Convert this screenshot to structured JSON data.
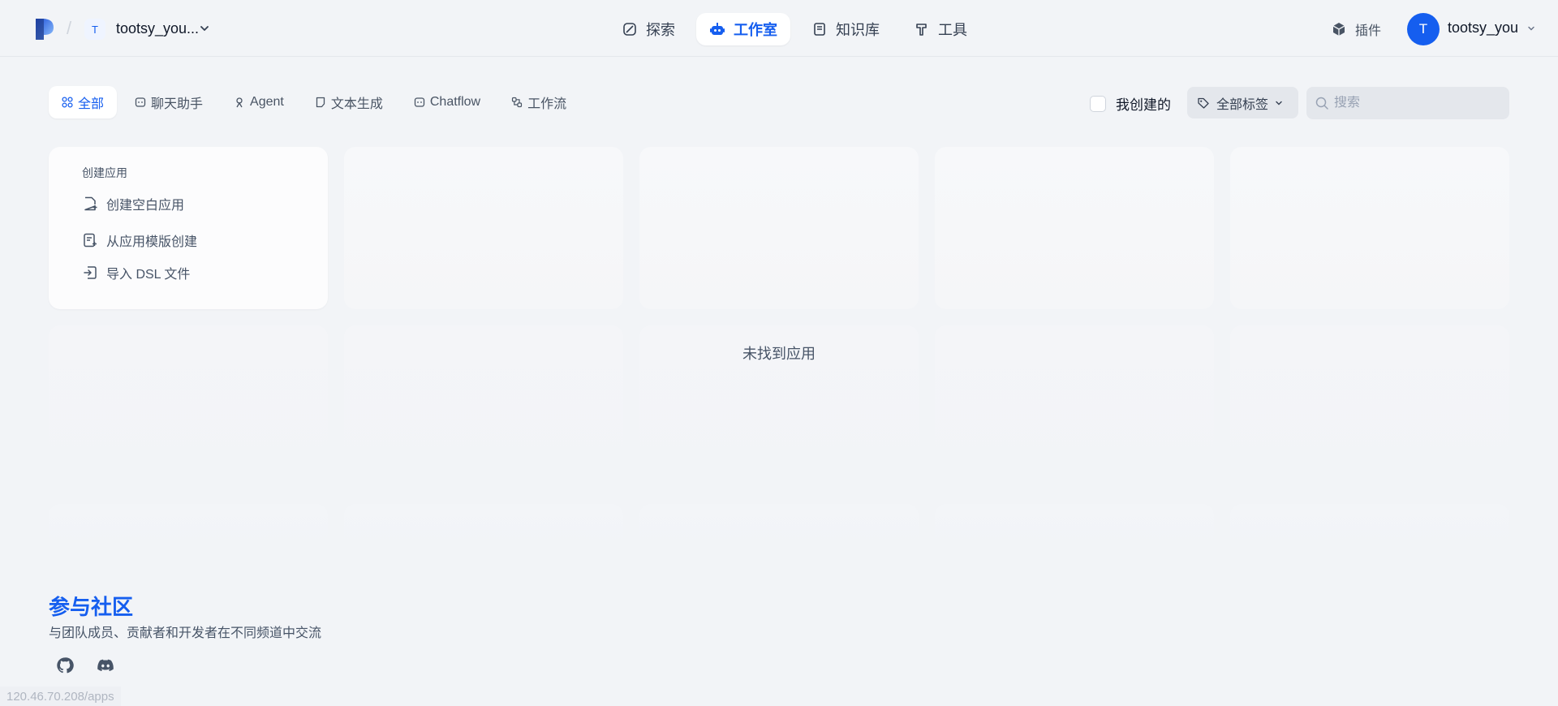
{
  "header": {
    "workspace_initial": "T",
    "workspace_name": "tootsy_you...",
    "nav": [
      {
        "label": "探索",
        "icon": "compass-icon",
        "active": false
      },
      {
        "label": "工作室",
        "icon": "robot-icon",
        "active": true
      },
      {
        "label": "知识库",
        "icon": "book-icon",
        "active": false
      },
      {
        "label": "工具",
        "icon": "hammer-icon",
        "active": false
      }
    ],
    "plugin_label": "插件",
    "user_initial": "T",
    "user_name": "tootsy_you"
  },
  "filters": {
    "tabs": [
      {
        "label": "全部",
        "icon": "grid-icon",
        "active": true
      },
      {
        "label": "聊天助手",
        "icon": "chat-icon",
        "active": false
      },
      {
        "label": "Agent",
        "icon": "agent-icon",
        "active": false
      },
      {
        "label": "文本生成",
        "icon": "document-icon",
        "active": false
      },
      {
        "label": "Chatflow",
        "icon": "chatflow-icon",
        "active": false
      },
      {
        "label": "工作流",
        "icon": "workflow-icon",
        "active": false
      }
    ],
    "mine_label": "我创建的",
    "tag_label": "全部标签",
    "search_placeholder": "搜索"
  },
  "create_card": {
    "title": "创建应用",
    "items": [
      {
        "label": "创建空白应用",
        "icon": "file-plus-icon"
      },
      {
        "label": "从应用模版创建",
        "icon": "template-icon"
      },
      {
        "label": "导入 DSL 文件",
        "icon": "import-icon"
      }
    ]
  },
  "empty_message": "未找到应用",
  "community": {
    "title": "参与社区",
    "subtitle": "与团队成员、贡献者和开发者在不同频道中交流",
    "links": [
      {
        "icon": "github-icon"
      },
      {
        "icon": "discord-icon"
      }
    ]
  },
  "status_url": "120.46.70.208/apps",
  "colors": {
    "accent": "#155eef",
    "background": "#f2f4f7"
  }
}
